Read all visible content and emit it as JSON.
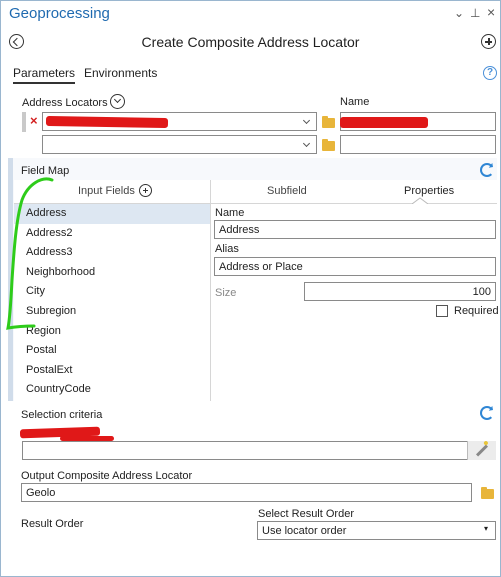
{
  "window": {
    "title": "Geoprocessing"
  },
  "title_controls": {
    "menu": "⌄",
    "pin": "4",
    "close": "×"
  },
  "tool": {
    "title": "Create Composite Address Locator"
  },
  "tabs": [
    {
      "label": "Parameters"
    },
    {
      "label": "Environments"
    }
  ],
  "address_locators": {
    "label": "Address Locators",
    "name_label": "Name",
    "rows": [
      {
        "value": "",
        "name": ""
      },
      {
        "value": "",
        "name": ""
      }
    ]
  },
  "field_map": {
    "label": "Field Map",
    "headers": {
      "input_fields": "Input Fields",
      "subfield": "Subfield",
      "properties": "Properties"
    },
    "items": [
      {
        "label": "Address"
      },
      {
        "label": "Address2"
      },
      {
        "label": "Address3"
      },
      {
        "label": "Neighborhood"
      },
      {
        "label": "City"
      },
      {
        "label": "Subregion"
      },
      {
        "label": "Region"
      },
      {
        "label": "Postal"
      },
      {
        "label": "PostalExt"
      },
      {
        "label": "CountryCode"
      }
    ],
    "selected_index": 0,
    "properties": {
      "name_label": "Name",
      "name_value": "Address",
      "alias_label": "Alias",
      "alias_value": "Address or Place",
      "size_label": "Size",
      "size_value": "100",
      "required_label": "Required",
      "required_checked": false
    }
  },
  "selection_criteria": {
    "label": "Selection criteria",
    "value": ""
  },
  "output_locator": {
    "label": "Output Composite Address Locator",
    "value": "Geolo"
  },
  "result_order": {
    "label": "Result Order",
    "select_label": "Select Result Order",
    "selected": "Use locator order"
  },
  "colors": {
    "accent": "#1f6ab0",
    "refresh": "#2f86d4",
    "redaction": "#e01818",
    "annotation": "#2ecc1a"
  }
}
